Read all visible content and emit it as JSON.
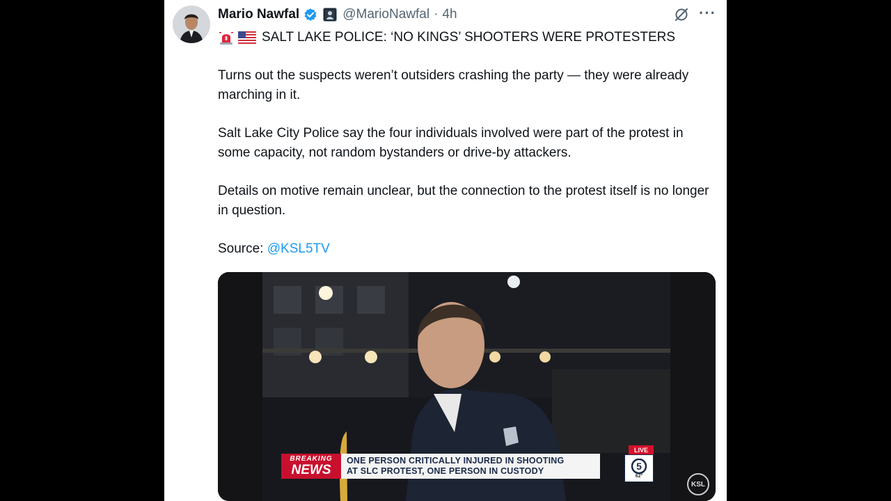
{
  "tweet": {
    "author_name": "Mario Nawfal",
    "handle": "@MarioNawfal",
    "separator": "·",
    "time": "4h",
    "headline": "SALT LAKE POLICE: ‘NO KINGS’ SHOOTERS WERE PROTESTERS",
    "paragraphs": [
      "Turns out the suspects weren’t outsiders crashing the party — they were already marching in it.",
      "Salt Lake City Police say the four individuals involved were part of the protest in some capacity, not random bystanders or drive-by attackers.",
      "Details on motive remain unclear, but the connection to the protest itself is no longer in question."
    ],
    "source_label": "Source:",
    "source_link": "@KSL5TV",
    "icons": [
      "verified-badge-icon",
      "affiliate-badge-icon",
      "grok-icon",
      "more-icon",
      "siren-emoji-icon",
      "us-flag-emoji-icon"
    ]
  },
  "video": {
    "breaking_line1": "BREAKING",
    "breaking_line2": "NEWS",
    "ticker_line1": "ONE PERSON CRITICALLY INJURED IN SHOOTING",
    "ticker_line2": "AT SLC PROTEST, ONE PERSON IN CUSTODY",
    "live_label": "LIVE",
    "channel_number": "5",
    "temperature": "62°",
    "bug_label": "KSL"
  },
  "colors": {
    "link": "#1d9bf0",
    "verified": "#1d9bf0",
    "breaking": "#c8102e",
    "text": "#0f1419",
    "muted": "#536471"
  }
}
